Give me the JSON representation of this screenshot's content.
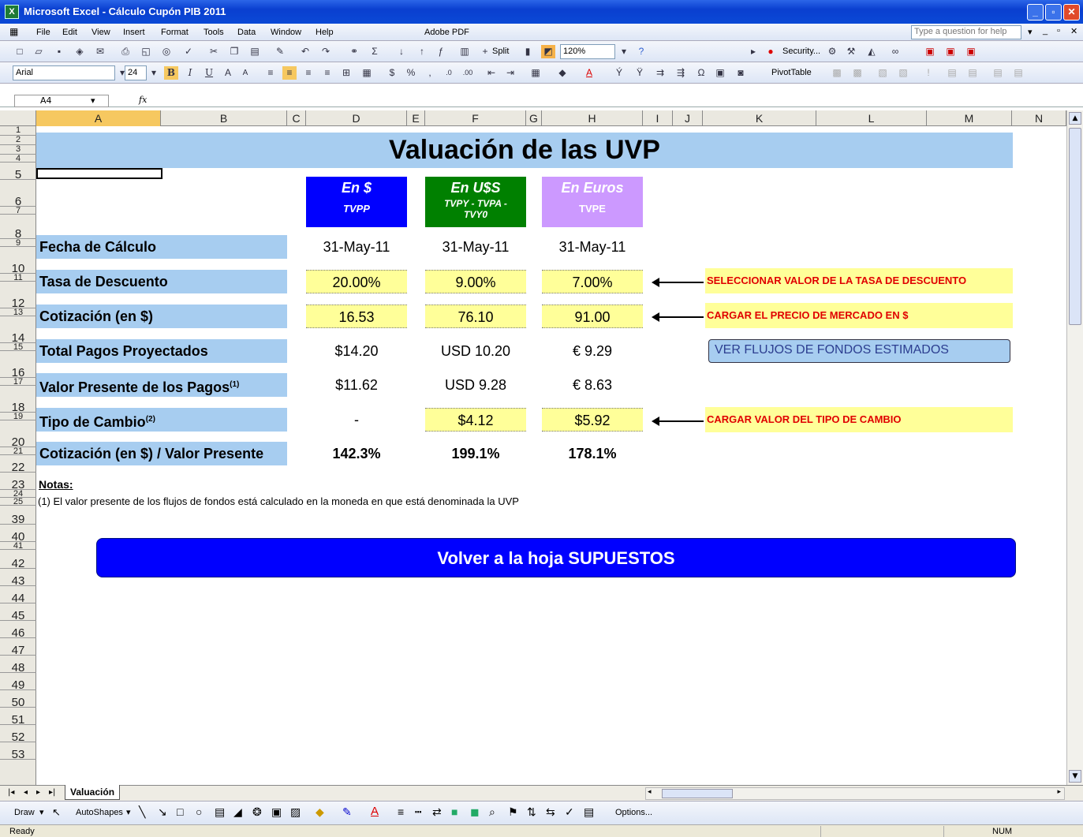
{
  "window": {
    "title": "Microsoft Excel - Cálculo Cupón PIB 2011"
  },
  "menubar": {
    "items": [
      "File",
      "Edit",
      "View",
      "Insert",
      "Format",
      "Tools",
      "Data",
      "Window",
      "Help",
      "Adobe PDF"
    ],
    "help_placeholder": "Type a question for help"
  },
  "toolbar": {
    "zoom": "120%",
    "split_label": "Split",
    "security_label": "Security...",
    "font_name": "Arial",
    "font_size": "24",
    "pivot_label": "PivotTable",
    "bold": "B",
    "italic": "I",
    "underline": "U"
  },
  "formula_bar": {
    "name_box": "A4",
    "fx": "fx",
    "formula": ""
  },
  "columns": [
    "A",
    "B",
    "C",
    "D",
    "E",
    "F",
    "G",
    "H",
    "I",
    "J",
    "K",
    "L",
    "M",
    "N"
  ],
  "rows": [
    "1",
    "2",
    "3",
    "4",
    "5",
    "6",
    "7",
    "8",
    "9",
    "10",
    "11",
    "12",
    "13",
    "14",
    "15",
    "16",
    "17",
    "18",
    "19",
    "20",
    "21",
    "22",
    "23",
    "24",
    "25",
    "39",
    "40",
    "41",
    "42",
    "43",
    "44",
    "45",
    "46",
    "47",
    "48",
    "49",
    "50",
    "51",
    "52",
    "53"
  ],
  "sheet": {
    "title": "Valuación de las UVP",
    "currency_headers": [
      {
        "main": "En $",
        "sub": "TVPP",
        "color": "#0000ff"
      },
      {
        "main": "En U$S",
        "sub": "TVPY - TVPA - TVY0",
        "color": "#008000"
      },
      {
        "main": "En Euros",
        "sub": "TVPE",
        "color": "#cc99ff"
      }
    ],
    "labels": {
      "fecha": "Fecha de Cálculo",
      "tasa": "Tasa de Descuento",
      "cotizacion": "Cotización (en $)",
      "total": "Total Pagos Proyectados",
      "vp": "Valor Presente de los Pagos",
      "vp_sup": "(1)",
      "tipo": "Tipo de Cambio",
      "tipo_sup": "(2)",
      "ratio": "Cotización (en $) / Valor Presente"
    },
    "values": {
      "fecha": [
        "31-May-11",
        "31-May-11",
        "31-May-11"
      ],
      "tasa": [
        "20.00%",
        "9.00%",
        "7.00%"
      ],
      "cotizacion": [
        "16.53",
        "76.10",
        "91.00"
      ],
      "total": [
        "$14.20",
        "USD 10.20",
        "€ 9.29"
      ],
      "vp": [
        "$11.62",
        "USD 9.28",
        "€ 8.63"
      ],
      "tipo": [
        "-",
        "$4.12",
        "$5.92"
      ],
      "ratio": [
        "142.3%",
        "199.1%",
        "178.1%"
      ]
    },
    "notes_side": {
      "tasa": "SELECCIONAR VALOR DE LA TASA DE DESCUENTO",
      "precio": "CARGAR EL PRECIO DE MERCADO EN $",
      "cambio": "CARGAR VALOR DEL TIPO DE CAMBIO"
    },
    "flujos_button": "VER FLUJOS DE FONDOS ESTIMADOS",
    "notas_title": "Notas:",
    "nota1": "(1) El valor presente de los flujos de fondos está calculado en la moneda en que está denominada la UVP",
    "volver_button": "Volver a la hoja SUPUESTOS"
  },
  "sheet_tab": "Valuación",
  "drawbar": {
    "draw": "Draw",
    "autoshapes": "AutoShapes",
    "options": "Options..."
  },
  "status": {
    "ready": "Ready",
    "num": "NUM"
  }
}
